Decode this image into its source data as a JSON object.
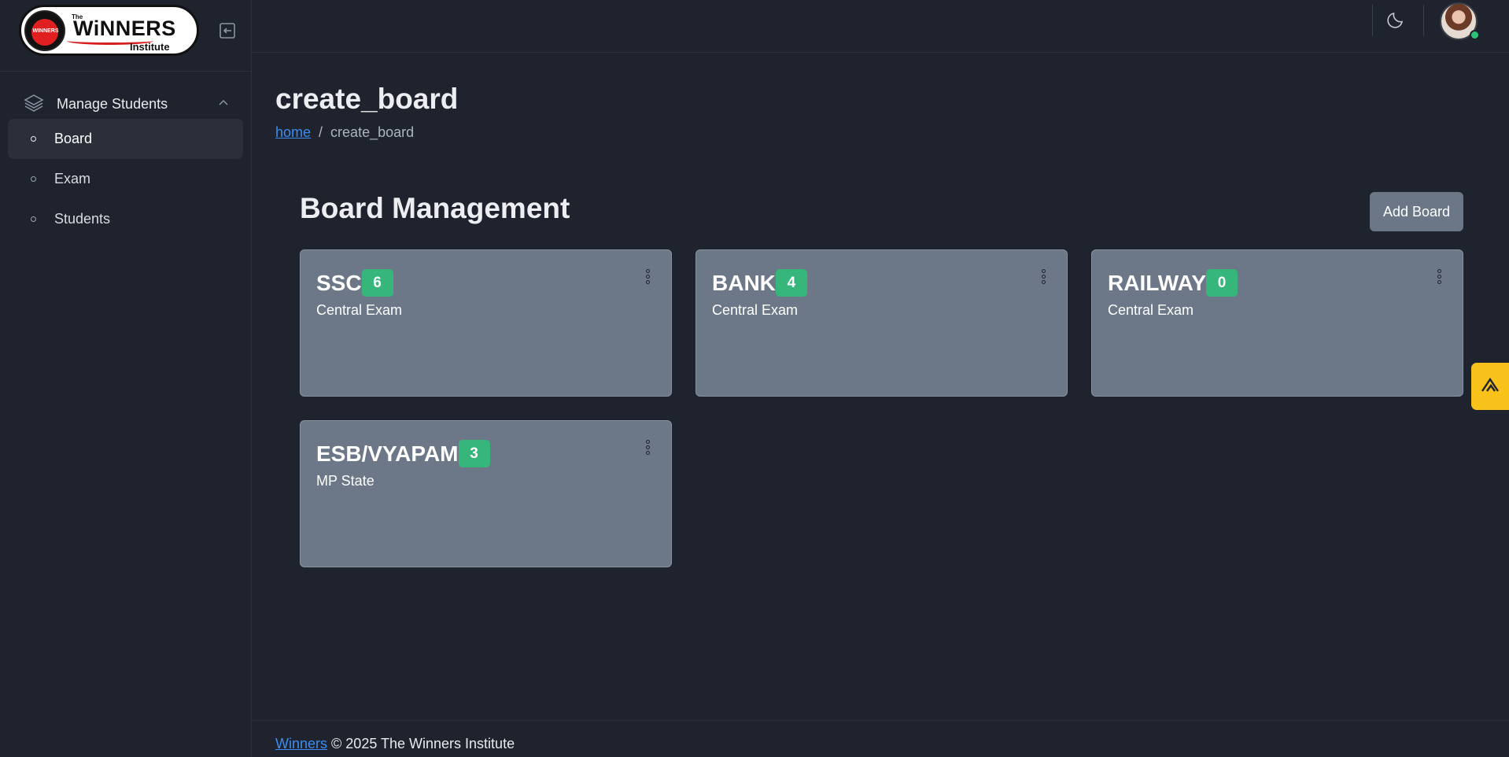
{
  "brand": {
    "logo_the": "The",
    "logo_name": "WiNNERS",
    "logo_sub": "Institute",
    "logo_seal_text": "WINNERS"
  },
  "sidebar": {
    "group_label": "Manage Students",
    "items": [
      {
        "label": "Board",
        "active": true
      },
      {
        "label": "Exam",
        "active": false
      },
      {
        "label": "Students",
        "active": false
      }
    ]
  },
  "header": {
    "page_title": "create_board",
    "breadcrumb": {
      "home": "home",
      "separator": "/",
      "current": "create_board"
    }
  },
  "main": {
    "section_title": "Board Management",
    "add_button": "Add Board",
    "boards": [
      {
        "name": "SSC",
        "count": "6",
        "subtitle": "Central Exam"
      },
      {
        "name": "BANK",
        "count": "4",
        "subtitle": "Central Exam"
      },
      {
        "name": "RAILWAY",
        "count": "0",
        "subtitle": "Central Exam"
      },
      {
        "name": "ESB/VYAPAM",
        "count": "3",
        "subtitle": "MP State"
      }
    ]
  },
  "footer": {
    "link": "Winners",
    "text": "© 2025 The Winners Institute"
  },
  "colors": {
    "background": "#1f232d",
    "card": "#6c7887",
    "badge": "#36b67b",
    "link": "#3b8df2",
    "side_tab": "#f8c21b"
  }
}
